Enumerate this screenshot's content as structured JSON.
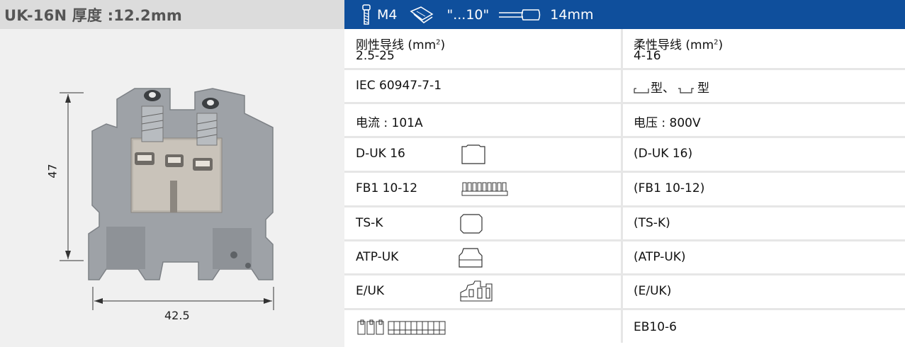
{
  "product": {
    "title": "UK-16N  厚度 :12.2mm",
    "dim_height": "47",
    "dim_width": "42.5"
  },
  "spec_header": {
    "screw": "M4",
    "screwdriver": "\"...10\"",
    "strip_length": "14mm"
  },
  "rows": [
    {
      "left": "刚性导线 (mm",
      "left_sup": "2",
      "left_close": ")",
      "left_value": "2.5-25",
      "right": "柔性导线 (mm",
      "right_sup": "2",
      "right_close": ")",
      "right_value": "4-16"
    },
    {
      "left": "IEC 60947-7-1",
      "right": "型、",
      "right_b": "型"
    },
    {
      "left": "电流 : 101A",
      "right": "电压 : 800V"
    },
    {
      "left": "D-UK 16",
      "left_icon": "end-cover-icon",
      "right": "(D-UK 16)"
    },
    {
      "left": "FB1 10-12",
      "left_icon": "jumper-bar-icon",
      "right": "(FB1 10-12)"
    },
    {
      "left": "TS-K",
      "left_icon": "ts-k-cover-icon",
      "right": "(TS-K)"
    },
    {
      "left": "ATP-UK",
      "left_icon": "separator-plate-icon",
      "right": "(ATP-UK)"
    },
    {
      "left": "E/UK",
      "left_icon": "end-clamp-icon",
      "right": "(E/UK)"
    },
    {
      "left_icon": "marker-strip-icon",
      "right": "EB10-6"
    }
  ],
  "colors": {
    "header_blue": "#0f4f9c",
    "left_header_gray": "#dcdcdc",
    "product_gray": "#9a9ea3"
  }
}
